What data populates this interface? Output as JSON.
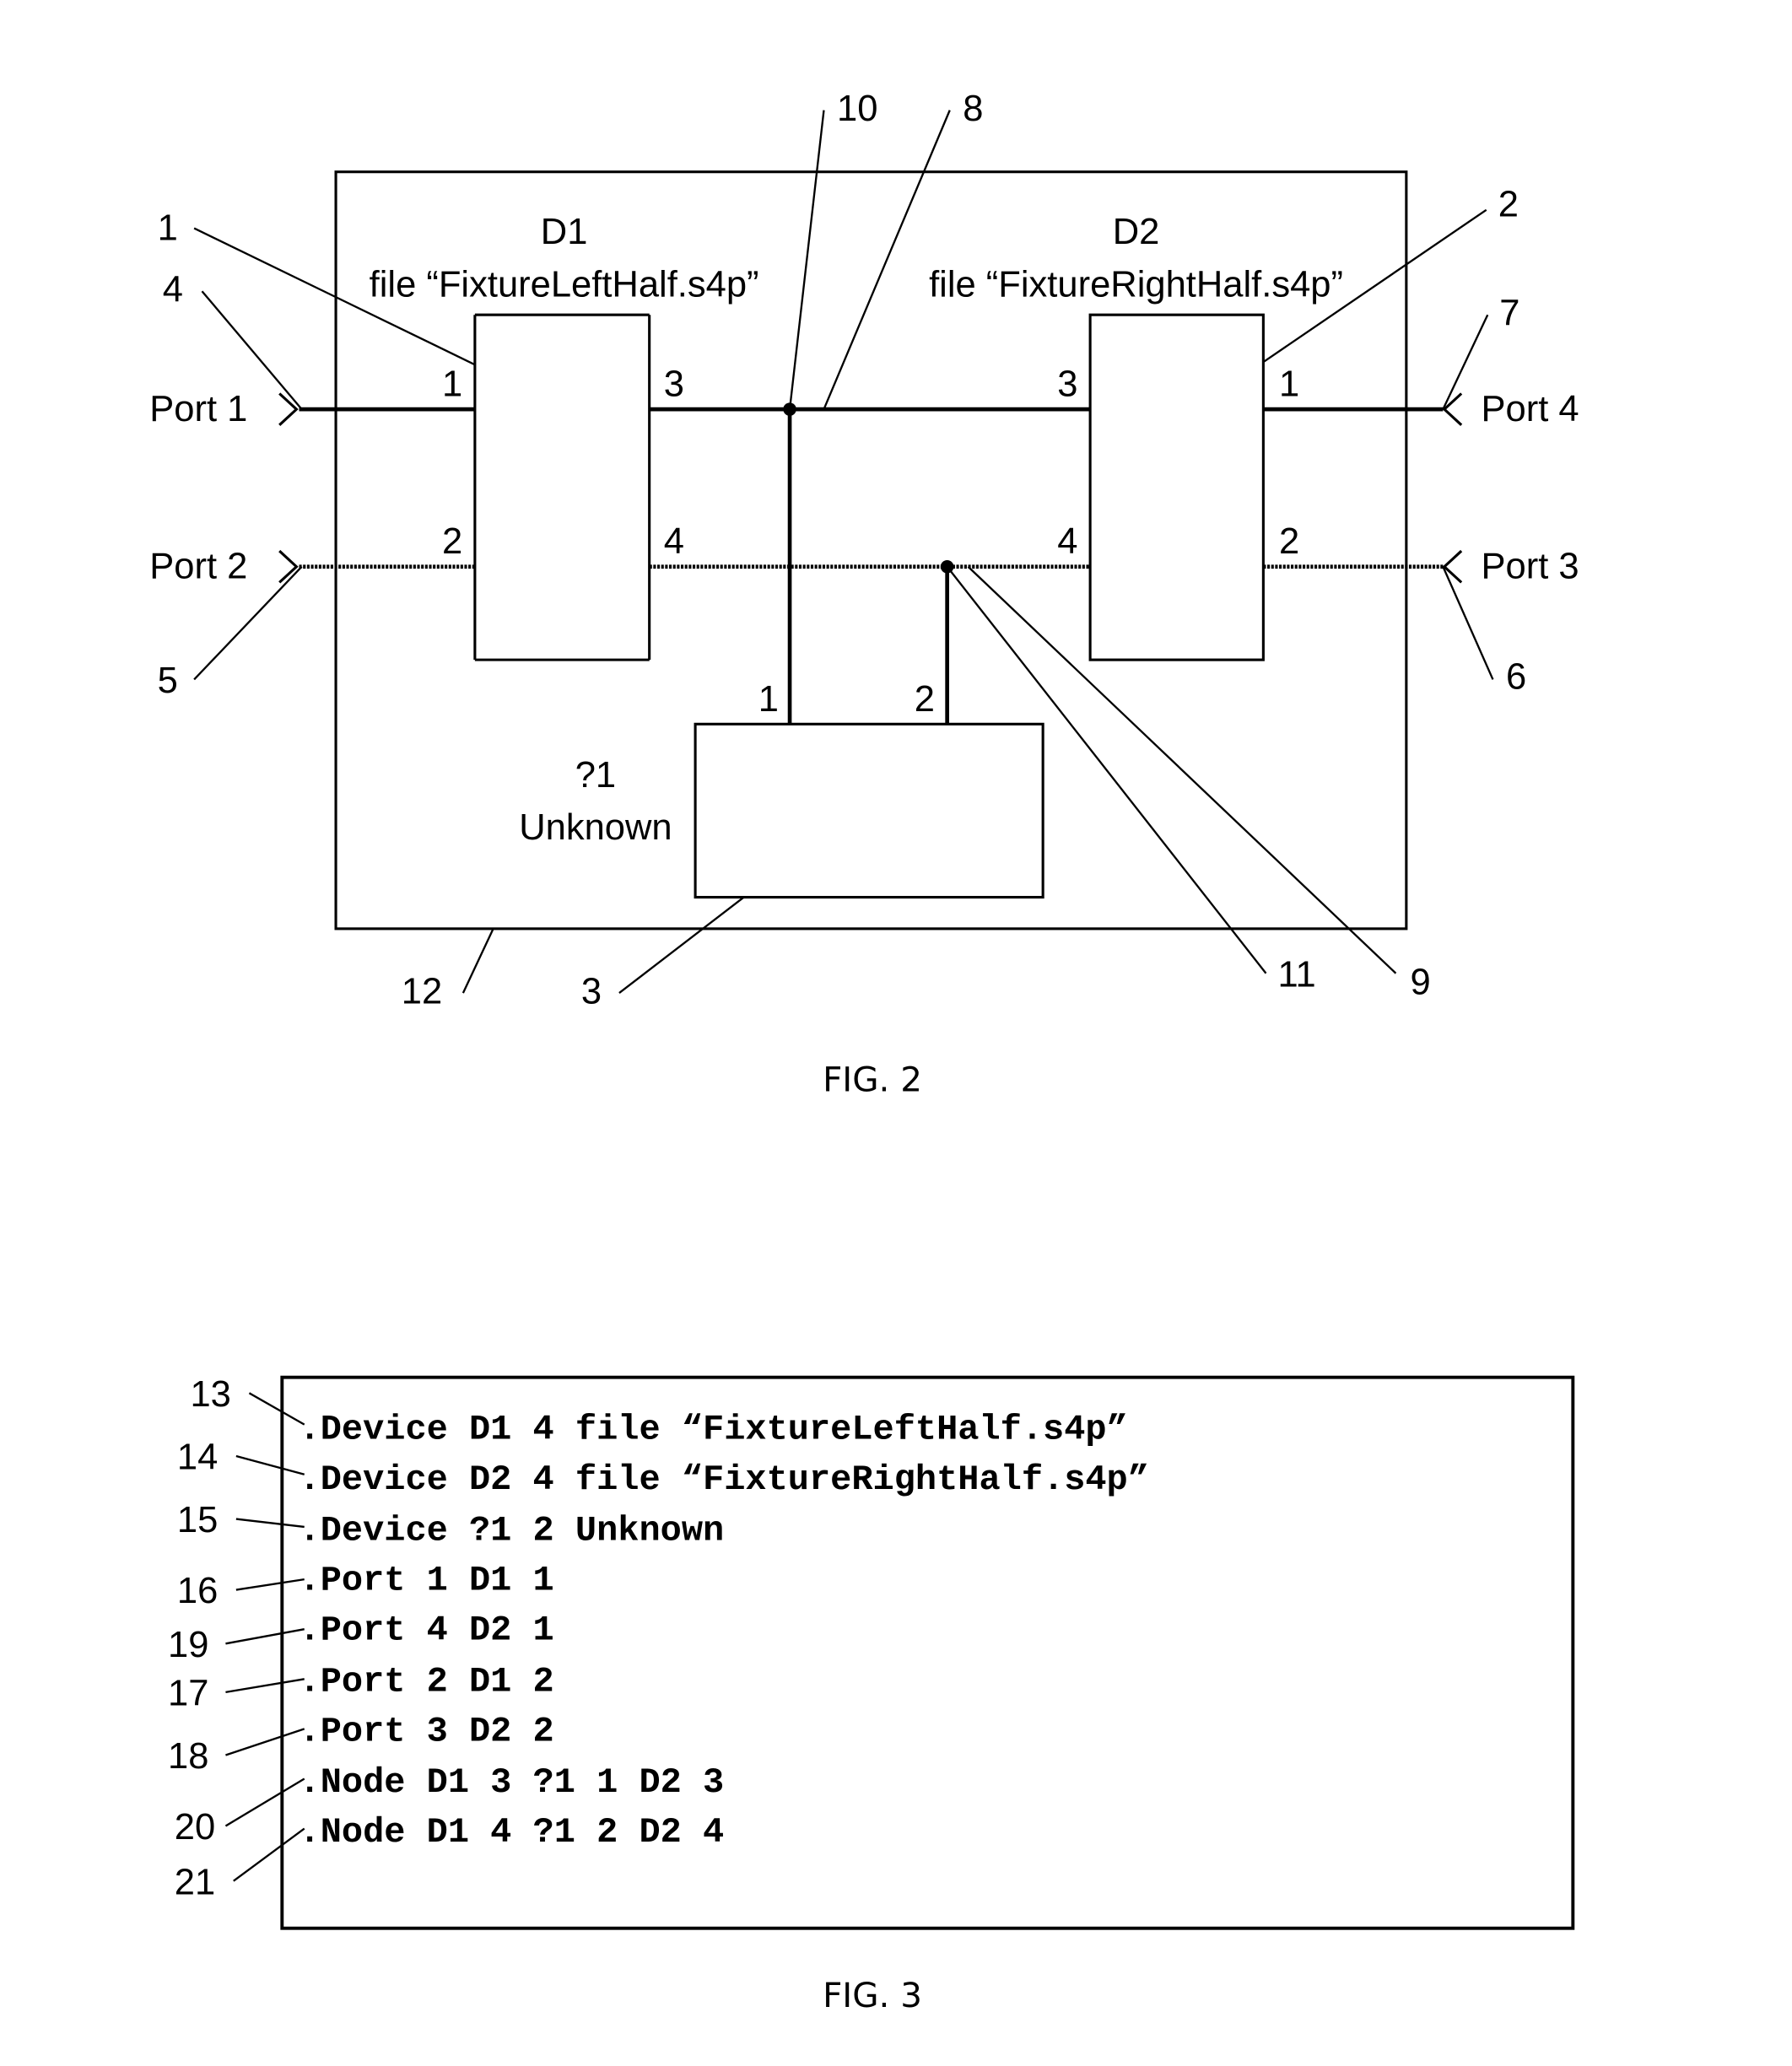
{
  "fig2": {
    "caption": "FIG. 2",
    "d1": {
      "name": "D1",
      "file": "file “FixtureLeftHalf.s4p”",
      "pins": [
        "1",
        "2",
        "3",
        "4"
      ]
    },
    "d2": {
      "name": "D2",
      "file": "file “FixtureRightHalf.s4p”",
      "pins": [
        "3",
        "4",
        "1",
        "2"
      ]
    },
    "unknown": {
      "name": "?1",
      "label": "Unknown",
      "pins": [
        "1",
        "2"
      ]
    },
    "ports": [
      "Port 1",
      "Port 2",
      "Port 4",
      "Port 3"
    ],
    "refs": [
      "1",
      "4",
      "5",
      "10",
      "8",
      "2",
      "7",
      "6",
      "12",
      "3",
      "11",
      "9"
    ]
  },
  "fig3": {
    "caption": "FIG. 3",
    "lines": [
      ".Device D1 4 file “FixtureLeftHalf.s4p”",
      ".Device D2 4 file “FixtureRightHalf.s4p”",
      ".Device ?1 2 Unknown",
      ".Port 1 D1 1",
      ".Port 4 D2 1",
      ".Port 2 D1 2",
      ".Port 3 D2 2",
      ".Node D1 3 ?1 1 D2 3",
      ".Node D1 4 ?1 2 D2 4"
    ],
    "refs": [
      "13",
      "14",
      "15",
      "16",
      "19",
      "17",
      "18",
      "20",
      "21"
    ]
  }
}
